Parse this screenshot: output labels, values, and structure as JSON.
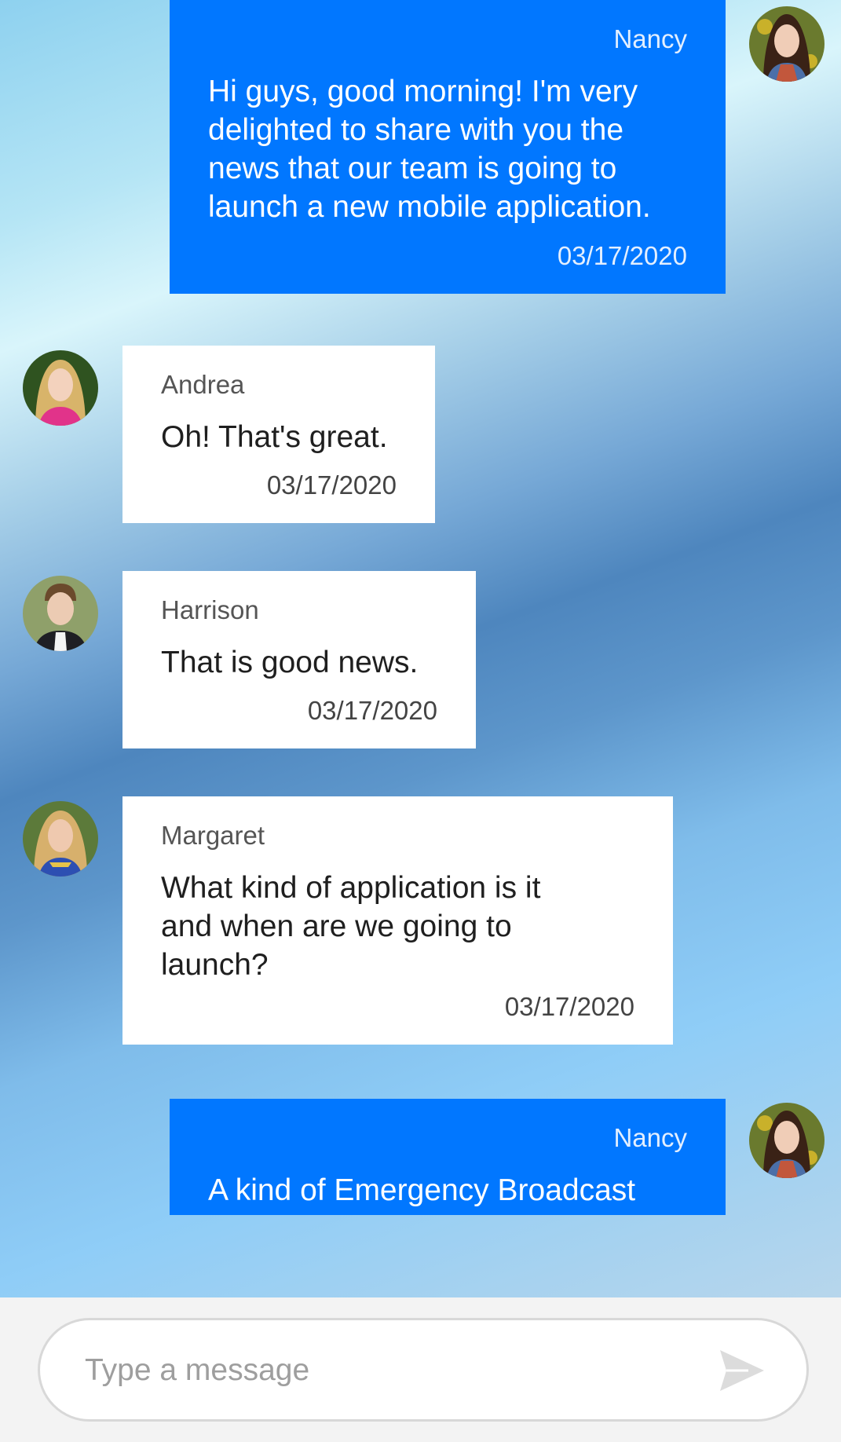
{
  "messages": [
    {
      "sender": "Nancy",
      "text": "Hi guys, good morning! I'm very delighted to share with you the news that our team is going to launch a new mobile application.",
      "time": "03/17/2020",
      "direction": "outgoing"
    },
    {
      "sender": "Andrea",
      "text": "Oh! That's great.",
      "time": "03/17/2020",
      "direction": "incoming"
    },
    {
      "sender": "Harrison",
      "text": "That is good news.",
      "time": "03/17/2020",
      "direction": "incoming"
    },
    {
      "sender": "Margaret",
      "text": "What kind of application is it and when are we going to launch?",
      "time": "03/17/2020",
      "direction": "incoming"
    },
    {
      "sender": "Nancy",
      "text": "A kind of Emergency Broadcast",
      "time": "",
      "direction": "outgoing"
    }
  ],
  "composer": {
    "placeholder": "Type a message",
    "send_icon": "send-icon"
  },
  "colors": {
    "outgoing_bubble": "#0177ff",
    "incoming_bubble": "#ffffff",
    "input_bar": "#f3f3f3"
  }
}
